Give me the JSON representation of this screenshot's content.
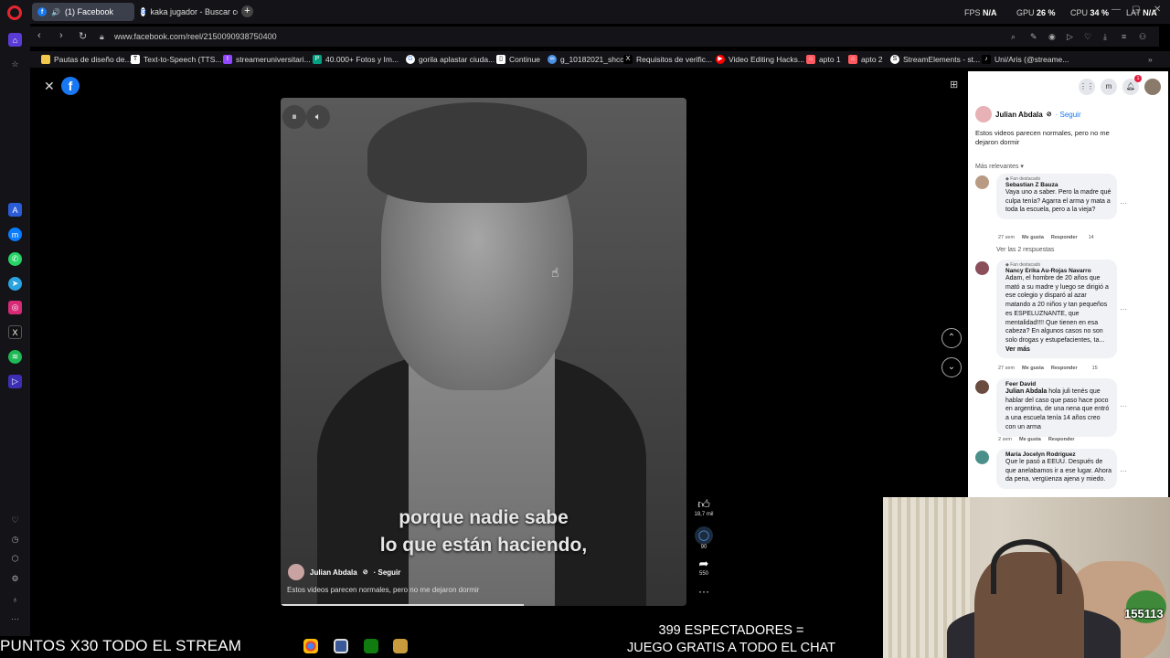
{
  "tabs": [
    {
      "label": "(1) Facebook",
      "active": true
    },
    {
      "label": "kaka jugador - Buscar con",
      "active": false
    }
  ],
  "stats": {
    "fps_label": "FPS",
    "fps_value": "N/A",
    "gpu_label": "GPU",
    "gpu_value": "26 %",
    "cpu_label": "CPU",
    "cpu_value": "34 %",
    "lat_label": "LAT",
    "lat_value": "N/A"
  },
  "address": {
    "url": "www.facebook.com/reel/2150090938750400"
  },
  "bookmarks": [
    {
      "label": "Pautas de diseño de...",
      "icon": "folder-icon",
      "color": "#f2c94c"
    },
    {
      "label": "Text-to-Speech (TTS...",
      "icon": "tts-icon",
      "color": "#ffffff"
    },
    {
      "label": "streameruniversitari...",
      "icon": "twitch-icon",
      "color": "#9146ff"
    },
    {
      "label": "40.000+ Fotos y Im...",
      "icon": "pexels-icon",
      "color": "#05a081"
    },
    {
      "label": "gorila aplastar ciuda...",
      "icon": "google-icon",
      "color": "#ffffff"
    },
    {
      "label": "Continue",
      "icon": "doc-icon",
      "color": "#ffffff"
    },
    {
      "label": "g_10182021_shcc",
      "icon": "link-icon",
      "color": "#4a90e2"
    },
    {
      "label": "Requisitos de verific...",
      "icon": "x-icon",
      "color": "#000000"
    },
    {
      "label": "Video Editing Hacks...",
      "icon": "youtube-icon",
      "color": "#ff0000"
    },
    {
      "label": "apto 1",
      "icon": "airbnb-icon",
      "color": "#ff5a5f"
    },
    {
      "label": "apto 2",
      "icon": "airbnb-icon",
      "color": "#ff5a5f"
    },
    {
      "label": "StreamElements - st...",
      "icon": "streamelements-icon",
      "color": "#ffffff"
    },
    {
      "label": "Uni/Aris (@streame...",
      "icon": "tiktok-icon",
      "color": "#000000"
    }
  ],
  "video": {
    "subtitle_line1": "porque nadie sabe",
    "subtitle_line2": "lo que están haciendo,",
    "author": "Julian Abdala",
    "follow": "· Seguir",
    "caption": "Estos videos parecen normales, pero no me dejaron dormir",
    "progress": 0.6
  },
  "rail": {
    "likes": "18,7 mil",
    "comments": "90",
    "shares": "550"
  },
  "panel": {
    "author": "Julian Abdala",
    "follow": "· Seguir",
    "caption": "Estos videos parecen normales, pero no me dejaron dormir",
    "sort": "Más relevantes",
    "comments": [
      {
        "badge": "Fan destacado",
        "name": "Sebastian Z Bauza",
        "text": "Vaya uno a saber. Pero la madre qué culpa tenía? Agarra el arma y mata a toda la escuela, pero a la vieja?",
        "time": "27 sem",
        "like": "Me gusta",
        "reply": "Responder",
        "reactions": "14",
        "replies": "Ver las 2 respuestas"
      },
      {
        "badge": "Fan destacado",
        "name": "Nancy Erika Au-Rojas Navarro",
        "text": "Adam, el hombre de 20 años que mató a su madre y luego se dirigió a ese colegio y disparó al azar matando a 20 niños y tan pequeños es ESPELUZNANTE, que mentalidad!!!! Que tienen en esa cabeza? En algunos casos no son solo drogas y estupefacientes, ta...",
        "more": "Ver más",
        "time": "27 sem",
        "like": "Me gusta",
        "reply": "Responder",
        "reactions": "15"
      },
      {
        "name": "Feer David",
        "mention": "Julian Abdala",
        "text": " hola juli tenés que hablar del caso que paso hace poco en argentina, de una nena que entró a una escuela tenía 14 años creo con un arma",
        "time": "2 sem",
        "like": "Me gusta",
        "reply": "Responder"
      },
      {
        "name": "Maria Jocelyn Rodriguez",
        "text": "Que le pasó a EEUU. Después de que anelabamos ir a ese lugar. Ahora da pena, vergüenza ajena y miedo."
      }
    ]
  },
  "stream": {
    "ticker": "PUNTOS X30 TODO EL STREAM",
    "overlay_line1": "399 ESPECTADORES =",
    "overlay_line2": "JUEGO GRATIS A TODO EL CHAT",
    "cam_count": "155113"
  }
}
